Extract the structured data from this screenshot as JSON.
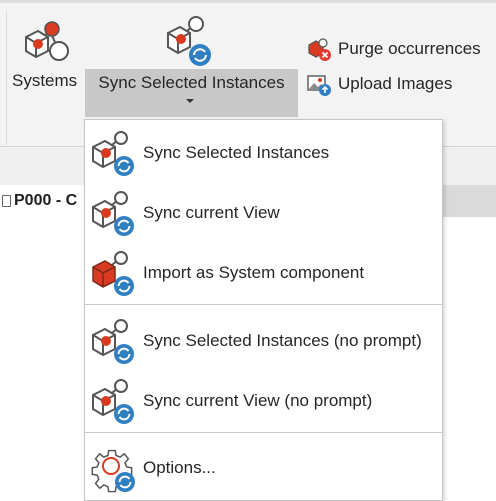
{
  "ribbon": {
    "systems_label": "Systems",
    "sync_label": "Sync Selected Instances",
    "purge_label": "Purge occurrences",
    "upload_label": "Upload Images"
  },
  "document_tab": {
    "title": "P000 - C"
  },
  "menu": {
    "items": [
      {
        "label": "Sync Selected Instances",
        "icon": "sync-instances-icon"
      },
      {
        "label": "Sync current View",
        "icon": "sync-view-icon"
      },
      {
        "label": "Import as System component",
        "icon": "import-component-icon"
      },
      {
        "label": "Sync Selected Instances (no prompt)",
        "icon": "sync-instances-icon"
      },
      {
        "label": "Sync current View (no prompt)",
        "icon": "sync-view-icon"
      },
      {
        "label": "Options...",
        "icon": "options-gear-icon"
      }
    ]
  },
  "colors": {
    "ribbon_bg": "#f3f3f3",
    "highlight": "#c8c8c8",
    "accent_red": "#d83b20",
    "accent_blue": "#2f7fc2"
  }
}
